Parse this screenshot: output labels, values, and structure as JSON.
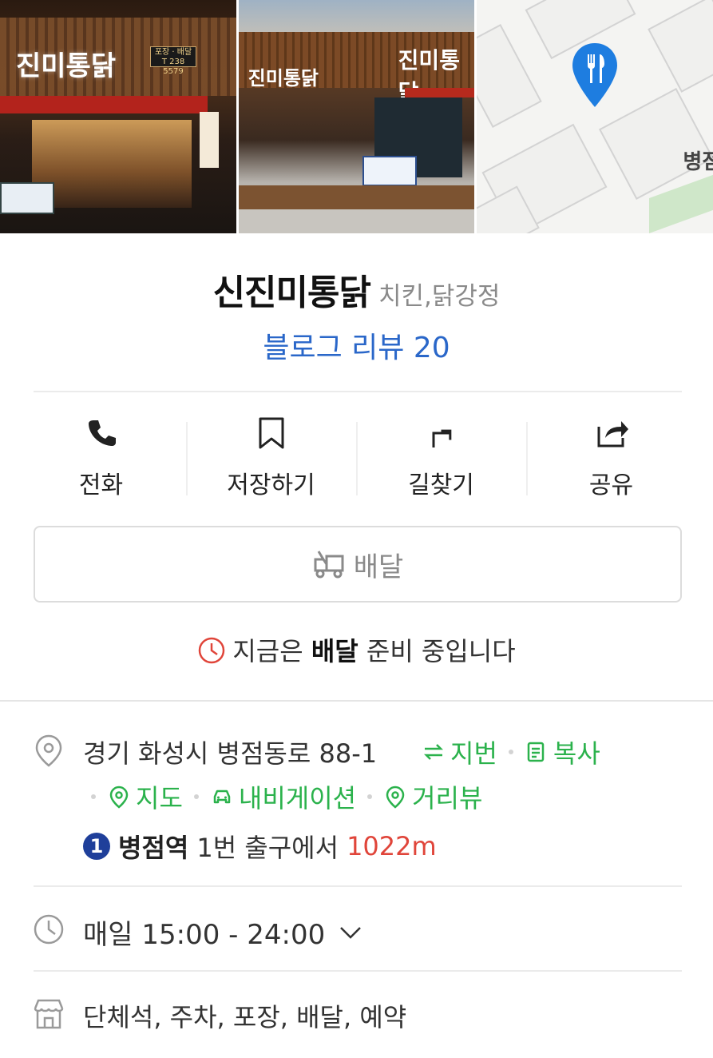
{
  "photos": {
    "photo1": {
      "sign_text": "진미통닭",
      "badge_line1": "포장 · 배달",
      "badge_line2": "T 238 5579"
    },
    "photo2": {
      "sign_text": "진미통닭",
      "side_sign_text": "진미통닭"
    },
    "map": {
      "label": "병점",
      "pin_icon": "fork-knife-icon"
    }
  },
  "place": {
    "name": "신진미통닭",
    "category": "치킨,닭강정",
    "blog_review": "블로그 리뷰 20"
  },
  "actions": [
    {
      "label": "전화",
      "icon": "phone-icon"
    },
    {
      "label": "저장하기",
      "icon": "bookmark-icon"
    },
    {
      "label": "길찾기",
      "icon": "directions-icon"
    },
    {
      "label": "공유",
      "icon": "share-icon"
    }
  ],
  "delivery": {
    "label": "배달",
    "icon": "delivery-truck-icon"
  },
  "status": {
    "prefix": "지금은",
    "emphasis": "배달",
    "suffix": "준비 중입니다"
  },
  "address": {
    "text": "경기 화성시 병점동로 88-1",
    "links": [
      {
        "label": "지번",
        "icon": "swap-icon"
      },
      {
        "label": "복사",
        "icon": "copy-icon"
      },
      {
        "label": "지도",
        "icon": "map-pin-icon"
      },
      {
        "label": "내비게이션",
        "icon": "car-icon"
      },
      {
        "label": "거리뷰",
        "icon": "street-view-icon"
      }
    ]
  },
  "subway": {
    "line": "1",
    "station": "병점역",
    "exit": "1번 출구에서",
    "distance": "1022m"
  },
  "hours": {
    "text": "매일 15:00 - 24:00"
  },
  "facilities": {
    "text": "단체석, 주차, 포장, 배달, 예약"
  },
  "colors": {
    "review_blue": "#2a67c9",
    "link_green": "#2bb24c",
    "distance_red": "#e0453a",
    "line1_blue": "#1f3f9a",
    "map_pin_blue": "#1e7de0"
  }
}
